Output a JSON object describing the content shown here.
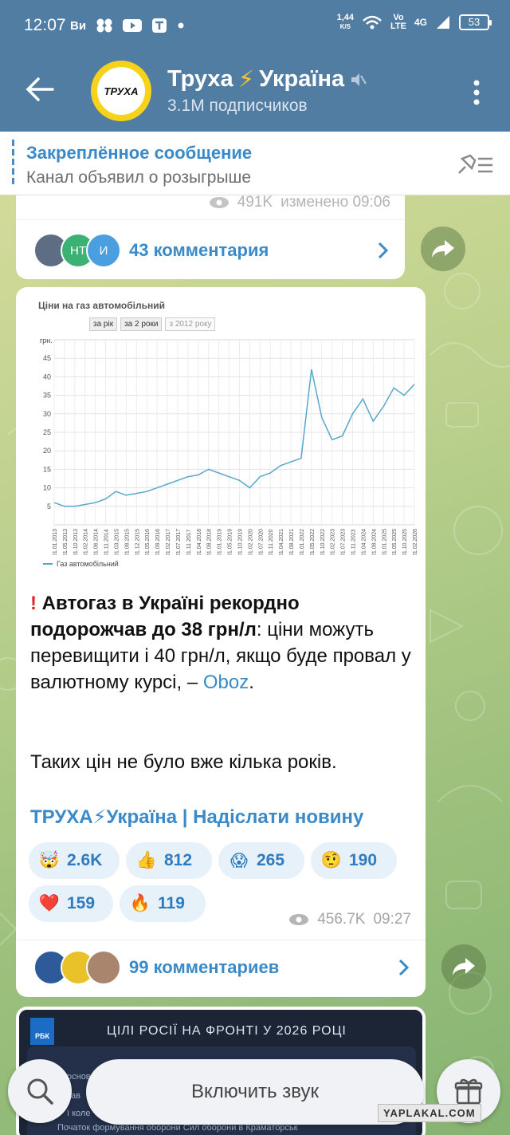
{
  "status": {
    "time": "12:07",
    "carrier_icons": [
      "Ви"
    ],
    "net_speed_top": "1,44",
    "net_speed_bottom": "K/S",
    "volte_top": "Vo",
    "volte_bottom": "LTE",
    "network": "4G",
    "battery": "53"
  },
  "header": {
    "title": "Труха",
    "title_flash": "⚡",
    "title_rest": "Україна",
    "subtitle": "3.1M подписчиков",
    "avatar_text": "ТРУХА"
  },
  "pinned": {
    "title": "Закреплённое сообщение",
    "text": "Канал объявил о розыгрыше"
  },
  "post1": {
    "views": "491K",
    "edited": "изменено 09:06",
    "avatar_labels": [
      "",
      "НТ",
      "И"
    ],
    "comments": "43 комментария"
  },
  "post2": {
    "chart_image": {
      "title": "Ціни на газ автомобільний",
      "tabs": [
        "за рік",
        "за 2 роки",
        "з 2012 року"
      ],
      "unit": "грн.",
      "legend": "Газ автомобільний"
    },
    "headline": "Автогаз в Україні рекордно подорожчав до 38 грн/л",
    "body_rest": ": ціни можуть перевищити і 40 грн/л, якщо буде провал у валютному курсі, –",
    "link": "Oboz",
    "period": ".",
    "para2": "Таких цін не було вже кілька років.",
    "signature": "ТРУХА⚡Україна | Надіслати новину",
    "reactions": [
      {
        "emoji": "🤯",
        "count": "2.6K"
      },
      {
        "emoji": "👍",
        "count": "812"
      },
      {
        "emoji": "😱",
        "count": "265"
      },
      {
        "emoji": "🤨",
        "count": "190"
      },
      {
        "emoji": "❤️",
        "count": "159"
      },
      {
        "emoji": "🔥",
        "count": "119"
      }
    ],
    "views": "456.7K",
    "time": "09:27",
    "comments": "99 комментариев"
  },
  "post3": {
    "logo": "РБК",
    "title": "ЦІЛІ РОСІЇ НА ФРОНТІ У 2026 РОЦІ",
    "lines": [
      "основ",
      "зав",
      "ї коле",
      "Початок формування оборони Сил оборони в Краматорськ"
    ]
  },
  "bottom": {
    "sound_button": "Включить звук",
    "watermark": "YAPLAKAL.COM"
  },
  "chart_data": {
    "type": "line",
    "title": "Ціни на газ автомобільний",
    "ylabel": "грн.",
    "ylim": [
      0,
      50
    ],
    "yticks": [
      5,
      10,
      15,
      20,
      25,
      30,
      35,
      40,
      45
    ],
    "xticks": [
      "01.01.2013",
      "01.05.2013",
      "01.10.2013",
      "01.02.2014",
      "01.06.2014",
      "01.11.2014",
      "01.03.2015",
      "01.08.2015",
      "01.12.2015",
      "01.05.2016",
      "01.09.2016",
      "01.02.2017",
      "01.07.2017",
      "01.11.2017",
      "01.04.2018",
      "01.08.2018",
      "01.01.2019",
      "01.05.2019",
      "01.10.2019",
      "01.02.2020",
      "01.07.2020",
      "01.11.2020",
      "01.04.2021",
      "01.08.2021",
      "01.01.2022",
      "01.05.2022",
      "01.10.2022",
      "01.02.2023",
      "01.07.2023",
      "01.11.2023",
      "01.04.2024",
      "01.08.2024",
      "01.01.2025",
      "01.05.2025",
      "01.10.2025",
      "01.02.2026"
    ],
    "series": [
      {
        "name": "Газ автомобільний",
        "color": "#57a7cc",
        "x_index": [
          0,
          1,
          2,
          3,
          4,
          5,
          6,
          7,
          8,
          9,
          10,
          11,
          12,
          13,
          14,
          15,
          16,
          17,
          18,
          19,
          20,
          21,
          22,
          23,
          24,
          25,
          26,
          27,
          28,
          29,
          30,
          31,
          32,
          33,
          34,
          35
        ],
        "values": [
          6,
          5,
          5,
          5.5,
          6,
          7,
          9,
          8,
          8.5,
          9,
          10,
          11,
          12,
          13,
          13.5,
          15,
          14,
          13,
          12,
          10,
          13,
          14,
          16,
          17,
          18,
          42,
          29,
          23,
          24,
          30,
          34,
          28,
          32,
          37,
          35,
          38
        ]
      }
    ],
    "grid": true,
    "legend_position": "bottom-left"
  }
}
